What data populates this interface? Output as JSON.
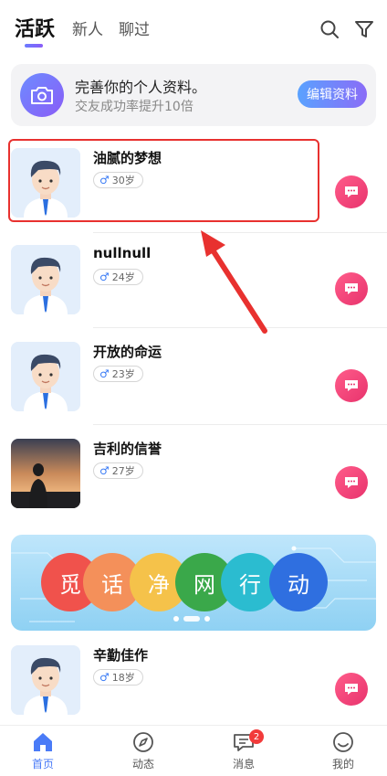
{
  "header": {
    "tabs": [
      {
        "label": "活跃",
        "active": true
      },
      {
        "label": "新人",
        "active": false
      },
      {
        "label": "聊过",
        "active": false
      }
    ],
    "icons": [
      "search-icon",
      "filter-icon"
    ]
  },
  "profile_card": {
    "title": "完善你的个人资料。",
    "subtitle": "交友成功率提升10倍",
    "button": "编辑资料"
  },
  "users": [
    {
      "name": "油腻的梦想",
      "gender": "♂",
      "age": "30岁",
      "avatar": "cartoon"
    },
    {
      "name": "nullnull",
      "gender": "♂",
      "age": "24岁",
      "avatar": "cartoon"
    },
    {
      "name": "开放的命运",
      "gender": "♂",
      "age": "23岁",
      "avatar": "cartoon"
    },
    {
      "name": "吉利的信誉",
      "gender": "♂",
      "age": "27岁",
      "avatar": "sunset"
    },
    {
      "name": "辛勤佳作",
      "gender": "♂",
      "age": "18岁",
      "avatar": "cartoon"
    }
  ],
  "promo": {
    "chars": [
      "觅",
      "话",
      "净",
      "网",
      "行",
      "动"
    ],
    "colors": [
      "#f0524c",
      "#f4905a",
      "#f5c24a",
      "#3aa84a",
      "#2bbcd0",
      "#2f6fe0"
    ]
  },
  "bottom_nav": [
    {
      "label": "首页",
      "icon": "home-icon",
      "active": true
    },
    {
      "label": "动态",
      "icon": "compass-icon",
      "active": false
    },
    {
      "label": "消息",
      "icon": "message-icon",
      "active": false,
      "badge": "2"
    },
    {
      "label": "我的",
      "icon": "profile-icon",
      "active": false
    }
  ],
  "accent_color": "#4a7bf7",
  "chat_color": "#e8336d"
}
